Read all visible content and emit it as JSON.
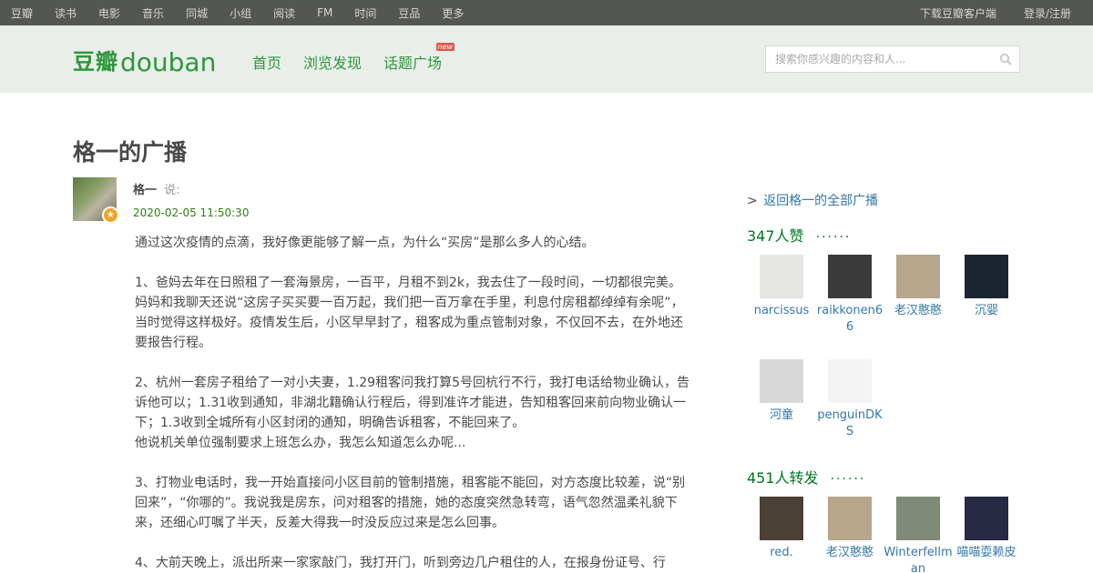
{
  "topbar": {
    "nav": [
      "豆瓣",
      "读书",
      "电影",
      "音乐",
      "同城",
      "小组",
      "阅读",
      "FM",
      "时间",
      "豆品",
      "更多"
    ],
    "download_client": "下载豆瓣客户端",
    "login": "登录/注册",
    "bg_color": "#545652"
  },
  "header": {
    "logo_cn": "豆瓣",
    "logo_en": "douban",
    "nav": [
      "首页",
      "浏览发现",
      "话题广场"
    ],
    "new_badge": "new",
    "search_placeholder": "搜索你感兴趣的内容和人...",
    "bg_color": "#e9efe8",
    "brand_color": "#2e963d"
  },
  "page": {
    "title": "格一的广播"
  },
  "status": {
    "author": "格一",
    "said": "说:",
    "timestamp": "2020-02-05 11:50:30",
    "paragraphs": [
      [
        "通过这次疫情的点滴，我好像更能够了解一点，为什么“买房”是那么多人的心结。"
      ],
      [
        "1、爸妈去年在日照租了一套海景房，一百平，月租不到2k，我去住了一段时间，一切都很完美。",
        "妈妈和我聊天还说“这房子买买要一百万起，我们把一百万拿在手里，利息付房租都绰绰有余呢”，",
        "当时觉得这样极好。疫情发生后，小区早早封了，租客成为重点管制对象，不仅回不去，在外地还",
        "要报告行程。"
      ],
      [
        "2、杭州一套房子租给了一对小夫妻，1.29租客问我打算5号回杭行不行，我打电话给物业确认，告",
        "诉他可以；1.31收到通知，非湖北籍确认行程后，得到准许才能进，告知租客回来前向物业确认一",
        "下；1.3收到全城所有小区封闭的通知，明确告诉租客，不能回来了。",
        "他说机关单位强制要求上班怎么办，我怎么知道怎么办呢..."
      ],
      [
        "3、打物业电话时，我一开始直接问小区目前的管制措施，租客能不能回，对方态度比较差，说“别",
        "回来”，“你哪的”。我说我是房东，问对租客的措施，她的态度突然急转弯，语气忽然温柔礼貌下",
        "来，还细心叮嘱了半天，反差大得我一时没反应过来是怎么回事。"
      ],
      [
        "4、大前天晚上，派出所来一家家敲门，我打开门，听到旁边几户租住的人，在报身份证号、行"
      ]
    ]
  },
  "sidebar": {
    "back_link": "返回格一的全部广播",
    "back_arrow": ">",
    "likes_title": "347人赞",
    "likes_dots": "······",
    "likers": [
      {
        "name": "narcissus",
        "color": "#e6e6e2"
      },
      {
        "name": "raikkonen66",
        "color": "#3a3a3a"
      },
      {
        "name": "老汉憨憨",
        "color": "#b7a58c"
      },
      {
        "name": "沉婴",
        "color": "#1b2430"
      },
      {
        "name": "河童",
        "color": "#d8d8d8"
      },
      {
        "name": "penguinDKS",
        "color": "#f4f4f4"
      }
    ],
    "reshares_title": "451人转发",
    "reshares_dots": "······",
    "resharers": [
      {
        "name": "red.",
        "color": "#4a4036"
      },
      {
        "name": "老汉憨憨",
        "color": "#b7a58c"
      },
      {
        "name": "Winterfellman",
        "color": "#7f8b78"
      },
      {
        "name": "喵喵耍赖皮",
        "color": "#262a44"
      }
    ],
    "link_color": "#3377aa",
    "section_color": "#007722"
  }
}
